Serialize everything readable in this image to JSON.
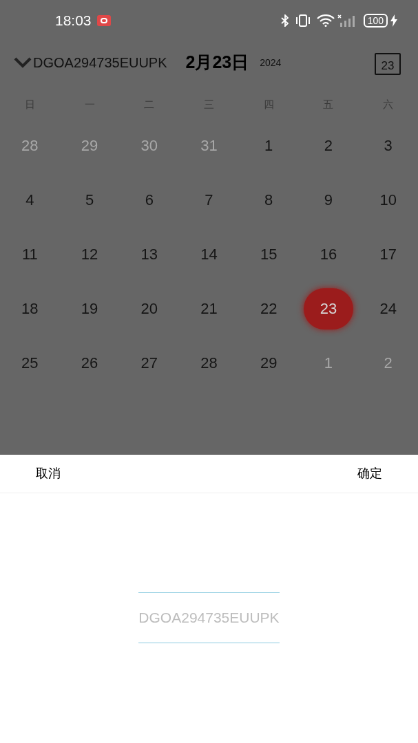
{
  "status_bar": {
    "time": "18:03",
    "battery": "100"
  },
  "header": {
    "device": "DGOA294735EUUPK",
    "date": "2月23日",
    "year": "2024",
    "today_icon": "23"
  },
  "weekdays": [
    "日",
    "一",
    "二",
    "三",
    "四",
    "五",
    "六"
  ],
  "days": [
    {
      "label": "28",
      "other_month": true,
      "selected": false
    },
    {
      "label": "29",
      "other_month": true,
      "selected": false
    },
    {
      "label": "30",
      "other_month": true,
      "selected": false
    },
    {
      "label": "31",
      "other_month": true,
      "selected": false
    },
    {
      "label": "1",
      "other_month": false,
      "selected": false
    },
    {
      "label": "2",
      "other_month": false,
      "selected": false
    },
    {
      "label": "3",
      "other_month": false,
      "selected": false
    },
    {
      "label": "4",
      "other_month": false,
      "selected": false
    },
    {
      "label": "5",
      "other_month": false,
      "selected": false
    },
    {
      "label": "6",
      "other_month": false,
      "selected": false
    },
    {
      "label": "7",
      "other_month": false,
      "selected": false
    },
    {
      "label": "8",
      "other_month": false,
      "selected": false
    },
    {
      "label": "9",
      "other_month": false,
      "selected": false
    },
    {
      "label": "10",
      "other_month": false,
      "selected": false
    },
    {
      "label": "11",
      "other_month": false,
      "selected": false
    },
    {
      "label": "12",
      "other_month": false,
      "selected": false
    },
    {
      "label": "13",
      "other_month": false,
      "selected": false
    },
    {
      "label": "14",
      "other_month": false,
      "selected": false
    },
    {
      "label": "15",
      "other_month": false,
      "selected": false
    },
    {
      "label": "16",
      "other_month": false,
      "selected": false
    },
    {
      "label": "17",
      "other_month": false,
      "selected": false
    },
    {
      "label": "18",
      "other_month": false,
      "selected": false
    },
    {
      "label": "19",
      "other_month": false,
      "selected": false
    },
    {
      "label": "20",
      "other_month": false,
      "selected": false
    },
    {
      "label": "21",
      "other_month": false,
      "selected": false
    },
    {
      "label": "22",
      "other_month": false,
      "selected": false
    },
    {
      "label": "23",
      "other_month": false,
      "selected": true
    },
    {
      "label": "24",
      "other_month": false,
      "selected": false
    },
    {
      "label": "25",
      "other_month": false,
      "selected": false
    },
    {
      "label": "26",
      "other_month": false,
      "selected": false
    },
    {
      "label": "27",
      "other_month": false,
      "selected": false
    },
    {
      "label": "28",
      "other_month": false,
      "selected": false
    },
    {
      "label": "29",
      "other_month": false,
      "selected": false
    },
    {
      "label": "1",
      "other_month": true,
      "selected": false
    },
    {
      "label": "2",
      "other_month": true,
      "selected": false
    }
  ],
  "sheet": {
    "cancel": "取消",
    "confirm": "确定",
    "options": [
      {
        "label": "DGOA294735EUUPK",
        "selected": true
      }
    ]
  }
}
